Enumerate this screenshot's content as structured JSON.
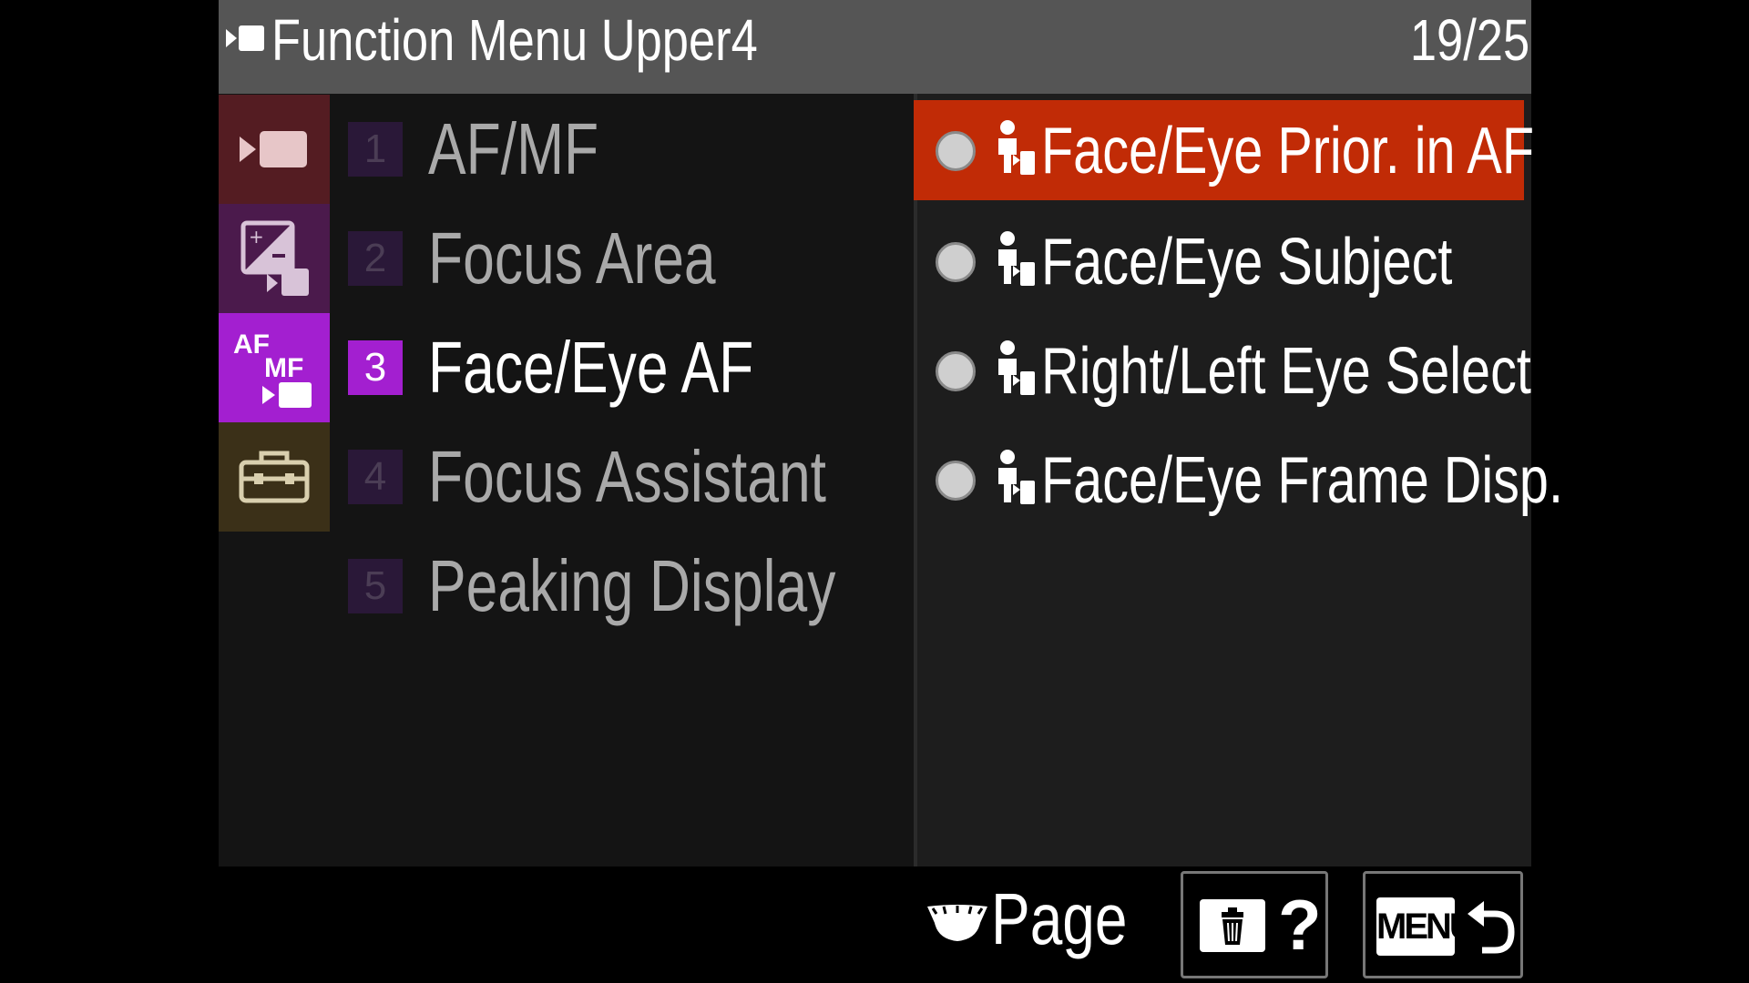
{
  "header": {
    "title": "Function Menu Upper4",
    "page_indicator": "19/25"
  },
  "tabs": [
    {
      "name": "shooting",
      "icon": "movie-camera-icon",
      "color": "#541c22"
    },
    {
      "name": "exposure-color",
      "icon": "exposure-color-icon",
      "color": "#4b1a4c"
    },
    {
      "name": "focus",
      "icon": "af-mf-icon",
      "color": "#a31fd0",
      "active": true
    },
    {
      "name": "setup",
      "icon": "toolbox-icon",
      "color": "#3b3018"
    }
  ],
  "menu": {
    "items": [
      {
        "num": "1",
        "label": "AF/MF"
      },
      {
        "num": "2",
        "label": "Focus Area"
      },
      {
        "num": "3",
        "label": "Face/Eye AF",
        "active": true
      },
      {
        "num": "4",
        "label": "Focus Assistant"
      },
      {
        "num": "5",
        "label": "Peaking Display"
      }
    ]
  },
  "options": {
    "items": [
      {
        "label": "Face/Eye Prior. in AF",
        "icon": "person-movie-icon",
        "selected": true
      },
      {
        "label": "Face/Eye Subject",
        "icon": "person-movie-icon"
      },
      {
        "label": "Right/Left Eye Select",
        "icon": "person-movie-icon"
      },
      {
        "label": "Face/Eye Frame Disp.",
        "icon": "person-movie-icon"
      }
    ]
  },
  "footer": {
    "page_label": "Page",
    "help_label": "?",
    "menu_label": "MENU"
  },
  "colors": {
    "accent_purple": "#a31fd0",
    "selected_orange": "#c12b06",
    "header_gray": "#555555"
  }
}
